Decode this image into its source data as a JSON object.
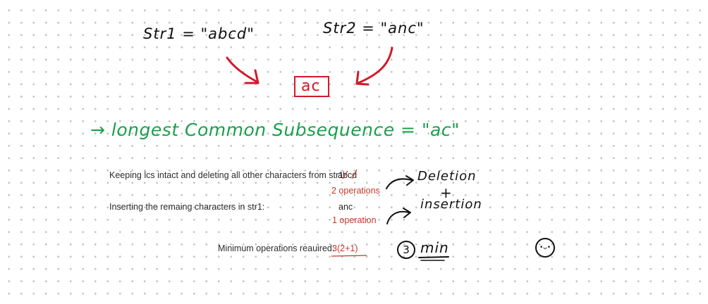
{
  "top": {
    "str1_label": "Str1 = \"abcd\"",
    "str2_label": "Str2 = \"anc\"",
    "lcs_box": "ac"
  },
  "lcs_line": "→ longest Common Subsequence = \"ac\"",
  "steps": {
    "delete_text": "Keeping lcs intact and deleting all other characters from str1:",
    "delete_value": "abcd",
    "delete_ops": "2 operations",
    "insert_text": "Inserting the remaing characters in str1:",
    "insert_value": "anc",
    "insert_ops": "1 operation",
    "min_label": "Minimum operations reauired:",
    "min_value": "3(2+1)"
  },
  "notes": {
    "deletion": "Deletion",
    "plus": "+",
    "insertion": "insertion",
    "circled_three": "3",
    "min": "min",
    "face": "•ᴗ•"
  },
  "colors": {
    "green": "#1aa04c",
    "red": "#d11a2a",
    "ink": "#111111"
  }
}
